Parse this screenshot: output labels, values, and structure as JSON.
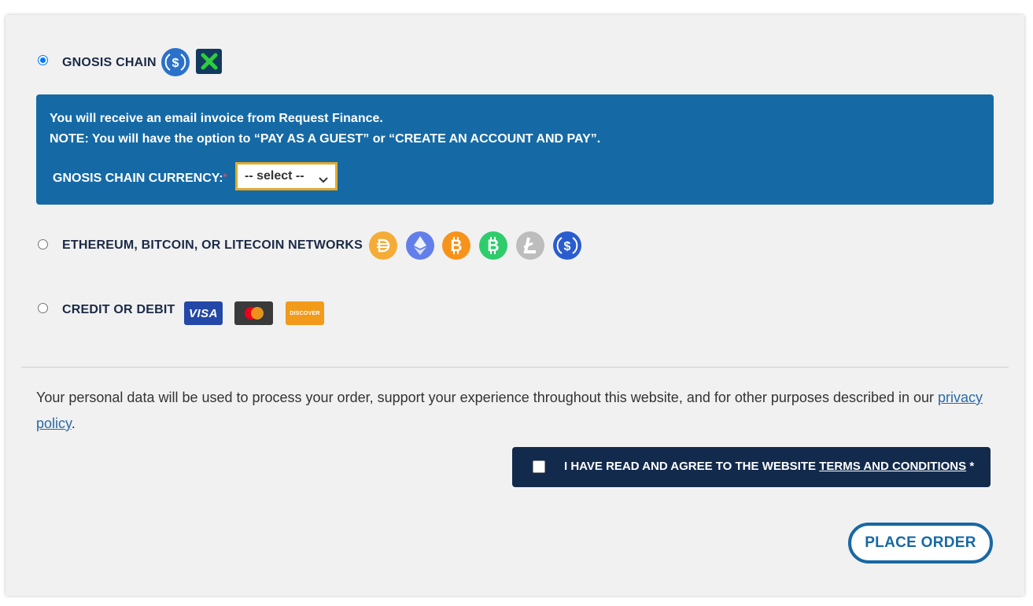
{
  "payment": {
    "gnosis": {
      "label": "GNOSIS CHAIN",
      "selected": true,
      "icons": [
        "usdc-icon",
        "xdai-icon"
      ],
      "info_line1": "You will receive an email invoice from Request Finance.",
      "info_line2": "NOTE: You will have the option to “PAY AS A GUEST” or “CREATE AN ACCOUNT AND PAY”.",
      "currency_label": "GNOSIS CHAIN CURRENCY:",
      "required_mark": "*",
      "currency_select_value": "-- select --"
    },
    "crypto": {
      "label": "ETHEREUM, BITCOIN, OR LITECOIN NETWORKS",
      "selected": false,
      "icons": [
        "dai-icon",
        "ethereum-icon",
        "bitcoin-icon",
        "bitcoin-cash-icon",
        "litecoin-icon",
        "usdc-icon"
      ]
    },
    "card": {
      "label": "CREDIT OR DEBIT",
      "selected": false,
      "visa": "VISA",
      "discover": "DISCOVER"
    }
  },
  "privacy": {
    "text": "Your personal data will be used to process your order, support your experience throughout this website, and for other purposes described in our ",
    "link": "privacy policy",
    "end": "."
  },
  "terms": {
    "text": "I HAVE READ AND AGREE TO THE WEBSITE ",
    "link": "TERMS AND CONDITIONS",
    "required": " *",
    "checked": false
  },
  "place_order_label": "PLACE ORDER",
  "colors": {
    "info_box": "#156aa6",
    "terms_bar": "#122a4c",
    "accent": "#1868a4",
    "select_border": "#e6a92a"
  }
}
